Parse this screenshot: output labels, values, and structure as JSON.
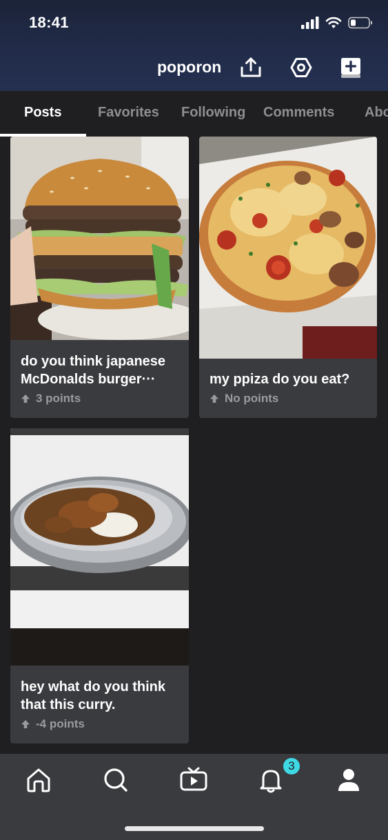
{
  "status_bar": {
    "time": "18:41"
  },
  "header": {
    "username": "poporon"
  },
  "tabs": [
    {
      "label": "Posts"
    },
    {
      "label": "Favorites"
    },
    {
      "label": "Following"
    },
    {
      "label": "Comments"
    },
    {
      "label": "Abo"
    }
  ],
  "posts": [
    {
      "title": "do you think japanese McDonalds burger···",
      "points": "3 points",
      "image": "burger-photo"
    },
    {
      "title": "my ppiza do you eat?",
      "points": "No points",
      "image": "pizza-photo"
    },
    {
      "title": "hey what do you think that this curry.",
      "points": "-4 points",
      "image": "curry-photo"
    }
  ],
  "bottom_nav": {
    "items": [
      "home-icon",
      "search-icon",
      "video-icon",
      "bell-icon",
      "profile-icon"
    ],
    "notification_count": "3"
  },
  "colors": {
    "background": "#1f1f21",
    "card": "#3a3b3f",
    "badge": "#3fd9e6",
    "header_gradient": "#222c4a"
  }
}
